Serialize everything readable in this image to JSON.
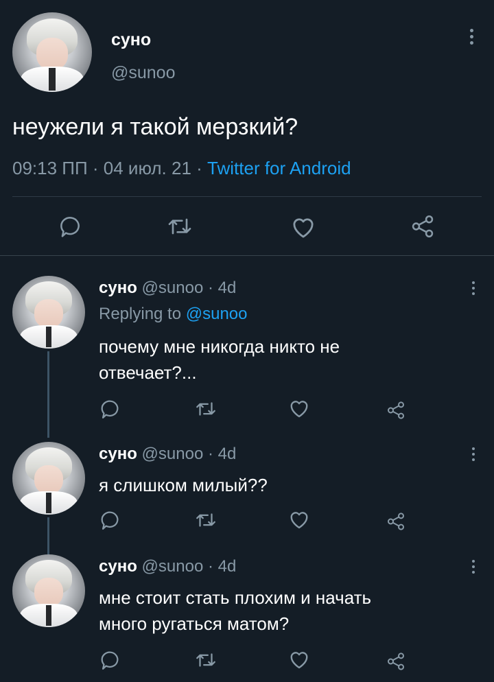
{
  "main_tweet": {
    "name": "суно",
    "handle": "@sunoo",
    "text": "неужели я такой мерзкий?",
    "time": "09:13 ПП",
    "sep1": " · ",
    "date": "04 июл. 21",
    "sep2": " · ",
    "client": "Twitter for Android",
    "actions": [
      "reply-icon",
      "retweet-icon",
      "like-icon",
      "share-icon"
    ]
  },
  "replies": [
    {
      "name": "суно",
      "handle": "@sunoo",
      "time": "· 4d",
      "replying_label": "Replying to",
      "replying_to": "@sunoo",
      "line1": "почему мне никогда никто не",
      "line2": "отвечает?..."
    },
    {
      "name": "суно",
      "handle": "@sunoo",
      "time": "· 4d",
      "line1": "я слишком милый??"
    },
    {
      "name": "суно",
      "handle": "@sunoo",
      "time": "· 4d",
      "line1": "мне стоит стать плохим и начать",
      "line2": "много ругаться матом?"
    }
  ],
  "colors": {
    "background": "#141d26",
    "secondary_text": "#8899a6",
    "accent": "#1da1f2",
    "divider": "#38444d"
  }
}
